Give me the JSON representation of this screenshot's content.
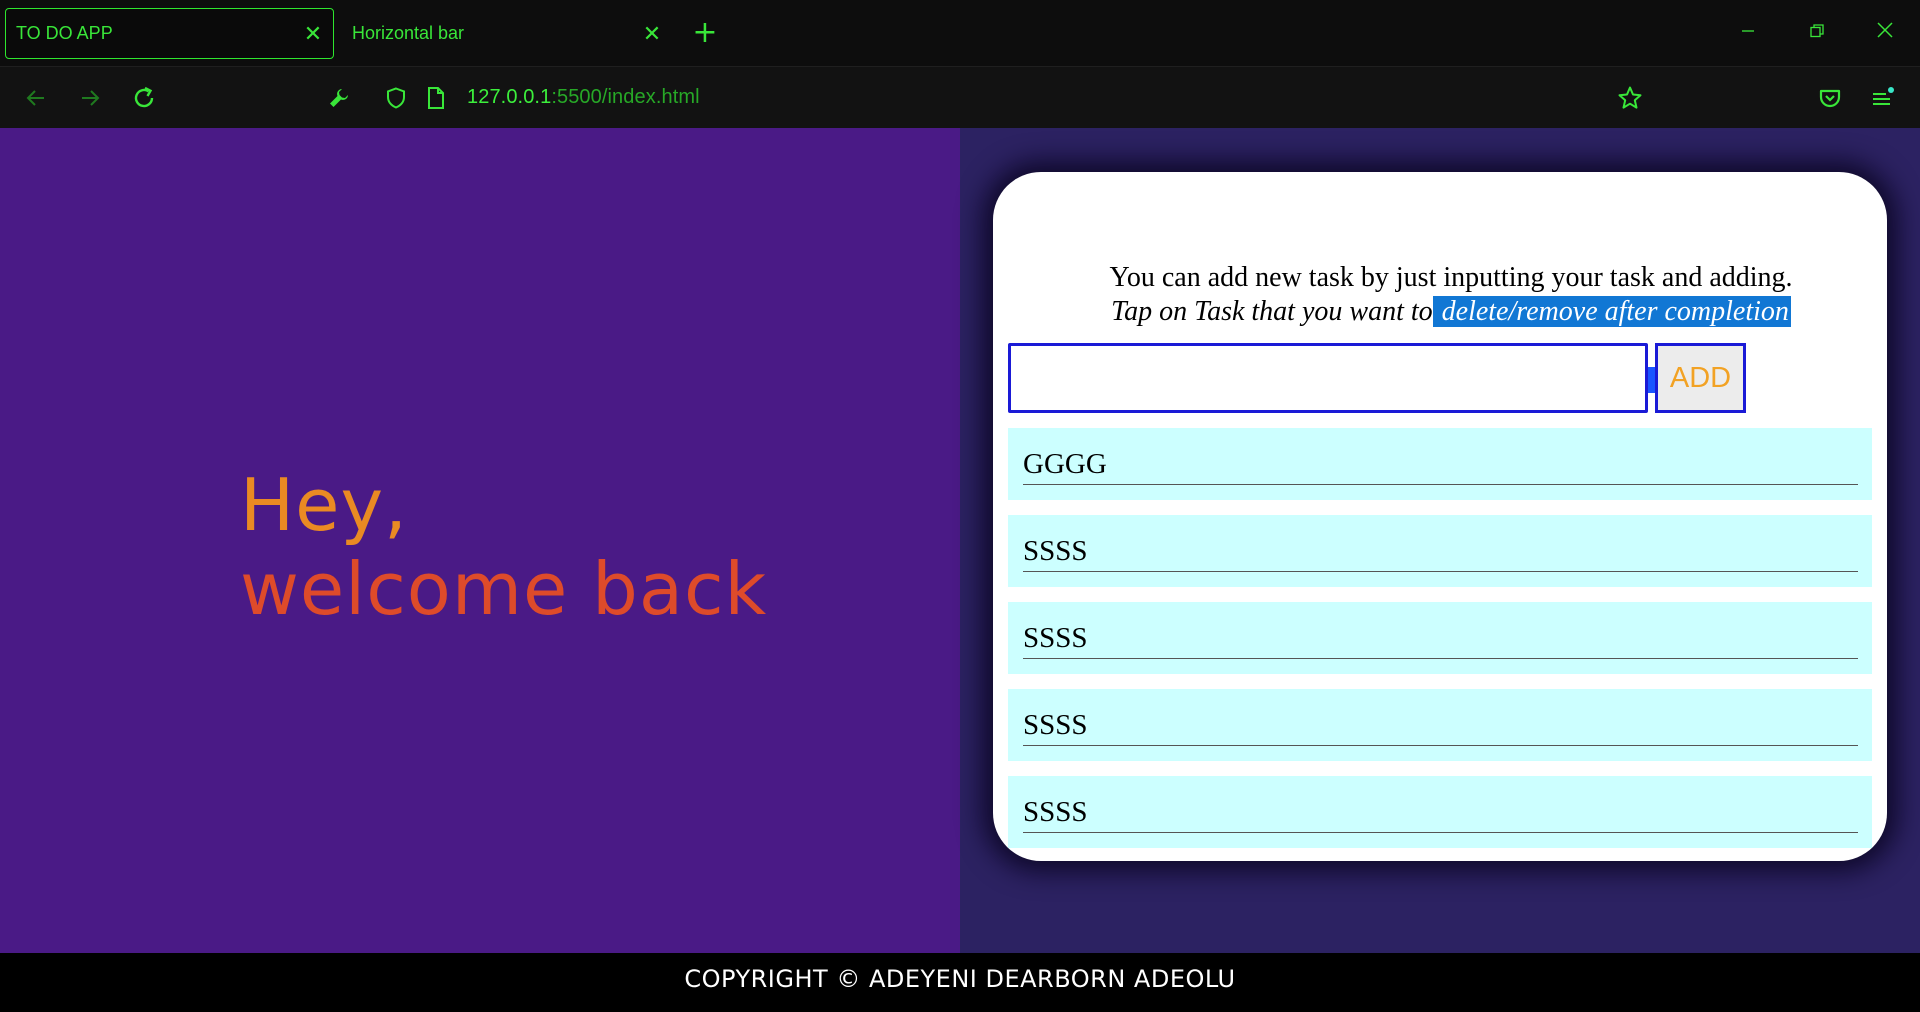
{
  "browser": {
    "tabs": [
      {
        "title": "TO DO APP",
        "close": "✕",
        "active": true
      },
      {
        "title": "Horizontal bar",
        "close": "✕",
        "active": false
      }
    ],
    "new_tab": "+",
    "window_controls": {
      "minimize": "—",
      "restore": "❐",
      "close": "✕"
    },
    "url": {
      "host": "127.0.0.1",
      "rest": ":5500/index.html"
    },
    "icons": [
      "back-arrow-icon",
      "forward-arrow-icon",
      "reload-icon",
      "wrench-icon",
      "shield-icon",
      "page-icon",
      "bookmark-star-icon",
      "pocket-icon",
      "menu-icon"
    ],
    "accent_color": "#39e639"
  },
  "left": {
    "greeting_line1": "Hey,",
    "greeting_line2": "welcome back",
    "background": "#4a1a86"
  },
  "card": {
    "instruction_line1": "You can add new task by just inputting your task and adding.",
    "instruction_line2_prefix": "Tap on Task that you want to",
    "instruction_line2_highlight": " delete/remove after completion",
    "input_value": "",
    "add_label": "ADD",
    "tasks": [
      "GGGG",
      "SSSS",
      "SSSS",
      "SSSS",
      "SSSS"
    ]
  },
  "footer": {
    "text": "COPYRIGHT © ADEYENI DEARBORN ADEOLU"
  }
}
